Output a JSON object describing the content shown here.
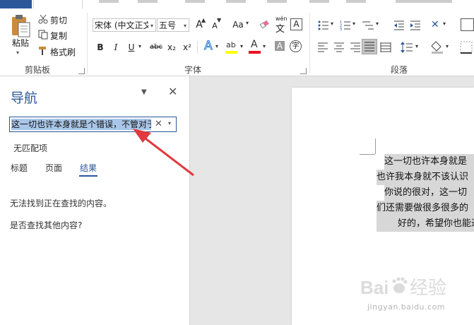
{
  "clipboard": {
    "cut": "剪切",
    "copy": "复制",
    "format_painter": "格式刷",
    "paste": "粘贴",
    "group_label": "剪贴板"
  },
  "font": {
    "name": "宋体 (中文正文)",
    "size": "五号",
    "group_label": "字体",
    "phonetic": "wén",
    "bold": "B",
    "italic": "I",
    "underline": "U",
    "strike": "abc",
    "subscript": "x₂",
    "superscript": "x²",
    "grow": "A",
    "shrink": "A",
    "case": "Aa",
    "char_border": "A",
    "text_effect": "A",
    "highlight": "ab",
    "font_color": "A",
    "char_shading": "A",
    "enclose": "字",
    "colors": {
      "highlight": "#ffff00",
      "font_color": "#e81123",
      "accent": "#2b579a"
    }
  },
  "paragraph": {
    "group_label": "段落"
  },
  "nav": {
    "title": "导航",
    "search_value": "这一切也许本身就是个错误，不管对于",
    "no_match": "无匹配项",
    "tabs": [
      "标题",
      "页面",
      "结果"
    ],
    "active_tab": "结果",
    "not_found": "无法找到正在查找的内容。",
    "find_other": "是否查找其他内容?"
  },
  "document": {
    "lines": [
      "这一切也许本身就是",
      "也许我本身就不该认识",
      "你说的很对，这一切",
      "们还需要做很多很多的",
      "好的，希望你也能过"
    ]
  },
  "watermark": {
    "brand_latin": "Bai",
    "brand_cn": "经验",
    "url": "jingyan.baidu.com"
  }
}
